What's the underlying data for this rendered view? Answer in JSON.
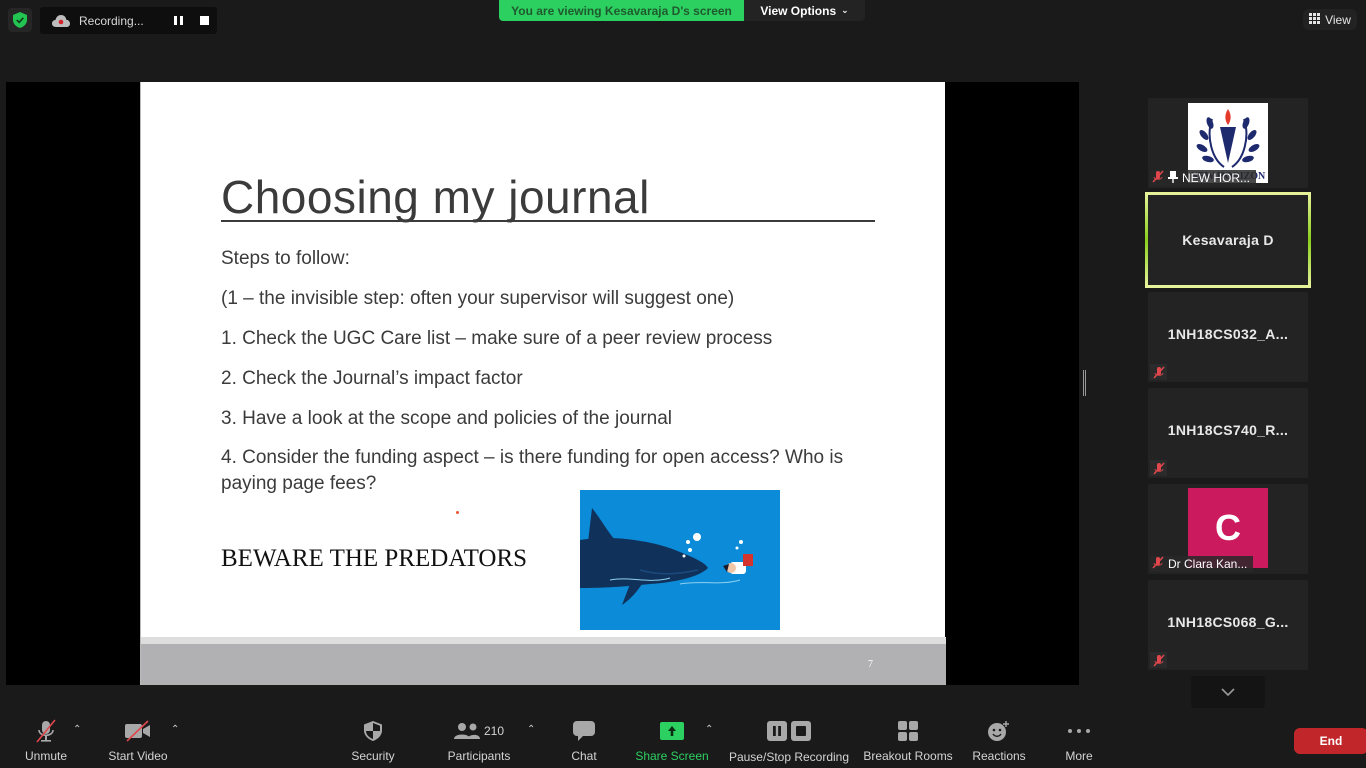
{
  "top_bar": {
    "recording_label": "Recording...",
    "viewing_banner": "You are viewing Kesavaraja D's screen",
    "view_options_label": "View Options",
    "view_label": "View"
  },
  "slide": {
    "title": "Choosing my journal",
    "lines": [
      "Steps to follow:",
      "(1 – the invisible step: often your supervisor will suggest one)",
      "1. Check the UGC Care list – make sure of a peer review process",
      "2. Check the Journal’s impact factor",
      "3. Have a look at the scope and policies of the journal",
      "4. Consider the funding aspect – is there funding for open access? Who is paying page fees?"
    ],
    "beware": "BEWARE THE PREDATORS",
    "page_number": "7"
  },
  "participants": [
    {
      "name": "NEW HOR...",
      "muted": true,
      "pinned": true,
      "logo_text": "NEW HORIZON"
    },
    {
      "name": "Kesavaraja D",
      "active_speaker": true
    },
    {
      "name": "1NH18CS032_A...",
      "muted": true
    },
    {
      "name": "1NH18CS740_R...",
      "muted": true
    },
    {
      "name": "Dr Clara Kan...",
      "muted": true,
      "avatar_letter": "C"
    },
    {
      "name": "1NH18CS068_G...",
      "muted": true
    }
  ],
  "toolbar": {
    "unmute": "Unmute",
    "start_video": "Start Video",
    "security": "Security",
    "participants_count": "210",
    "participants": "Participants",
    "chat": "Chat",
    "share_screen": "Share Screen",
    "pause_stop_recording": "Pause/Stop Recording",
    "breakout_rooms": "Breakout Rooms",
    "reactions": "Reactions",
    "more": "More",
    "end": "End"
  },
  "colors": {
    "accent_green": "#2cd061",
    "end_red": "#c1262a",
    "mute_red": "#e0474c",
    "avatar_pink": "#cc1a5f",
    "active_border": "#8ad01a"
  }
}
